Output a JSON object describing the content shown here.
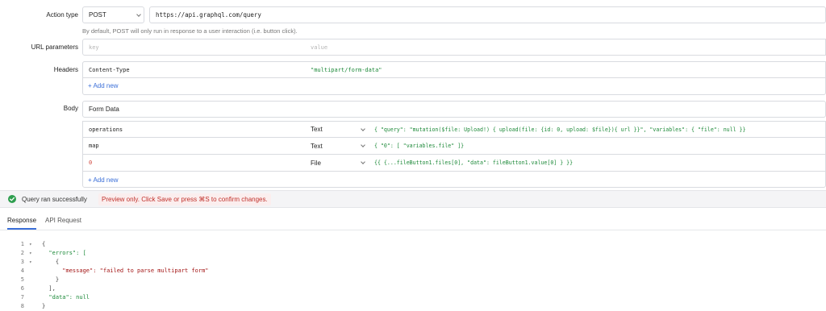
{
  "action": {
    "label": "Action type",
    "method": "POST",
    "url": "https://api.graphql.com/query",
    "hint": "By default, POST will only run in response to a user interaction (i.e. button click)."
  },
  "url_params": {
    "label": "URL parameters",
    "key_placeholder": "key",
    "value_placeholder": "value"
  },
  "headers": {
    "label": "Headers",
    "key": "Content-Type",
    "value": "\"multipart/form-data\"",
    "add_new": "+ Add new"
  },
  "body": {
    "label": "Body",
    "type": "Form Data",
    "rows": [
      {
        "key": "operations",
        "type": "Text",
        "value": "{  \"query\": \"mutation($file: Upload!) { upload(file: {id: 0, upload: $file}){ url }}\",  \"variables\": {    \"file\": null  }}"
      },
      {
        "key": "map",
        "type": "Text",
        "value": "{  \"0\": [    \"variables.file\"  ]}"
      },
      {
        "key": "0",
        "type": "File",
        "value": "{{ {...fileButton1.files[0], \"data\": fileButton1.value[0] } }}"
      }
    ],
    "add_new": "+ Add new"
  },
  "status": {
    "success": "Query ran successfully",
    "preview": "Preview only. Click Save or press ⌘S to confirm changes."
  },
  "tabs": {
    "response": "Response",
    "api_request": "API Request"
  },
  "response_lines": [
    {
      "n": "1",
      "fold": "▾",
      "text": "{"
    },
    {
      "n": "2",
      "fold": "▾",
      "text": "  \"errors\": ["
    },
    {
      "n": "3",
      "fold": "▾",
      "text": "    {"
    },
    {
      "n": "4",
      "fold": "",
      "text": "      \"message\": \"failed to parse multipart form\""
    },
    {
      "n": "5",
      "fold": "",
      "text": "    }"
    },
    {
      "n": "6",
      "fold": "",
      "text": "  ],"
    },
    {
      "n": "7",
      "fold": "",
      "text": "  \"data\": null"
    },
    {
      "n": "8",
      "fold": "",
      "text": "}"
    }
  ],
  "colors": {
    "accent": "#3b6fd8",
    "success": "#2e9e4f",
    "preview_red": "#c0312b",
    "code_green": "#1e8a3a"
  }
}
